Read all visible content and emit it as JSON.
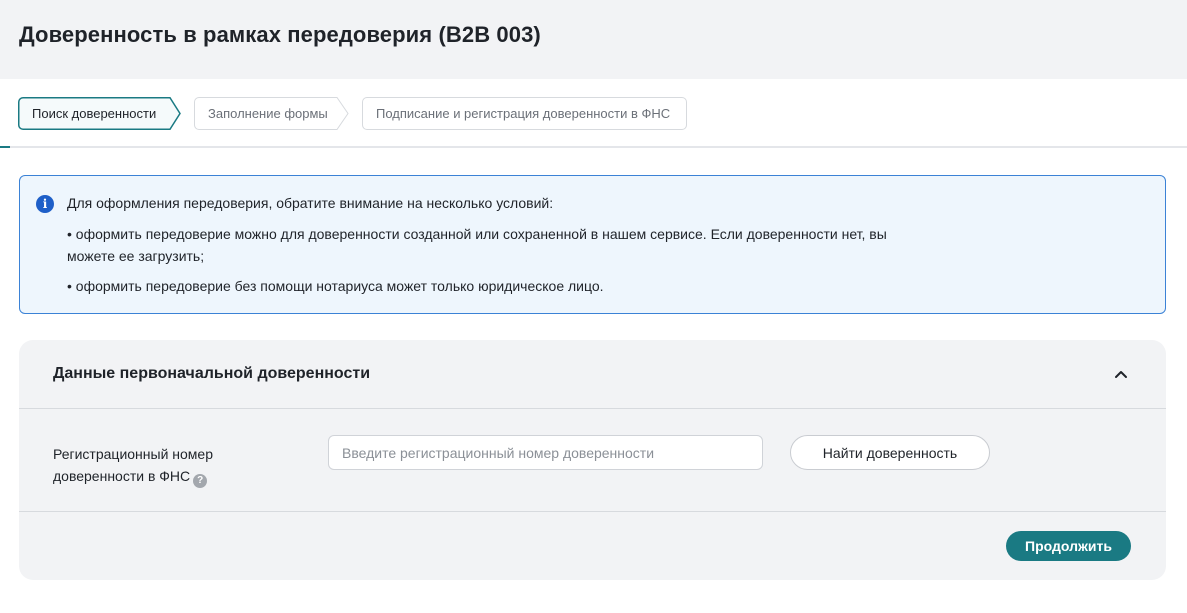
{
  "page": {
    "title": "Доверенность в рамках передоверия (B2B 003)"
  },
  "stepper": {
    "steps": [
      {
        "label": "Поиск доверенности",
        "state": "active"
      },
      {
        "label": "Заполнение формы",
        "state": "inactive"
      },
      {
        "label": "Подписание и регистрация доверенности в ФНС",
        "state": "inactive"
      }
    ]
  },
  "info": {
    "icon": "info-icon",
    "lines": [
      "Для оформления передоверия, обратите внимание на несколько условий:",
      "• оформить передоверие можно для доверенности созданной или сохраненной в нашем сервисе. Если доверенности нет, вы",
      "можете ее загрузить;",
      "• оформить передоверие без помощи нотариуса может только юридическое лицо."
    ]
  },
  "card": {
    "title": "Данные первоначальной доверенности",
    "collapse_icon": "chevron-up-icon",
    "field": {
      "label_line1": "Регистрационный номер",
      "label_line2": "доверенности в ФНС",
      "help_icon": "question-icon",
      "help_glyph": "?",
      "value": "",
      "placeholder": "Введите регистрационный номер доверенности"
    },
    "find_button": "Найти доверенность",
    "continue_button": "Продолжить"
  },
  "colors": {
    "accent": "#1a7a83",
    "info_border": "#3b82d6",
    "info_background": "#eef6fd",
    "card_background": "#f2f3f5"
  }
}
